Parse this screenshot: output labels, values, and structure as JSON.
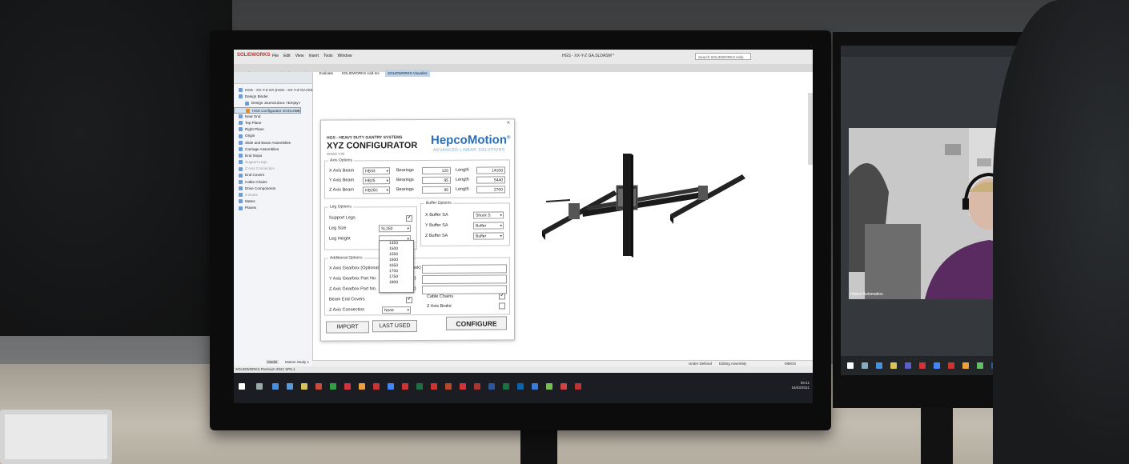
{
  "solidworks": {
    "logo": "SOLIDWORKS",
    "menu": [
      "File",
      "Edit",
      "View",
      "Insert",
      "Tools",
      "Window"
    ],
    "title": "HGS - XX-Y-Z GA.SLDASM *",
    "search_placeholder": "Search SOLIDWORKS Help",
    "tabs": [
      "Assembly",
      "Layout",
      "Sketch",
      "Markup",
      "Evaluate",
      "SOLIDWORKS Add-Ins",
      "SOLIDWORKS Visualize"
    ],
    "active_tab": "SOLIDWORKS Visualize",
    "tree": [
      {
        "label": "HGS - XX-Y-Z GA (HGS - XX-Y-Z GA<Disp",
        "level": 0,
        "state": "normal"
      },
      {
        "label": "Design Binder",
        "level": 0,
        "state": "normal"
      },
      {
        "label": "Design Journal.docx <Empty>",
        "level": 1,
        "state": "normal"
      },
      {
        "label": "HGS Configurator v0.93.xlsm",
        "level": 1,
        "state": "selected"
      },
      {
        "label": "Equations",
        "level": 0,
        "state": "normal"
      },
      {
        "label": "Near End",
        "level": 0,
        "state": "normal"
      },
      {
        "label": "Top Plane",
        "level": 0,
        "state": "normal"
      },
      {
        "label": "Right Plane",
        "level": 0,
        "state": "normal"
      },
      {
        "label": "Origin",
        "level": 0,
        "state": "normal"
      },
      {
        "label": "Slide and Beam Assemblies",
        "level": 0,
        "state": "normal"
      },
      {
        "label": "Carriage Assemblies",
        "level": 0,
        "state": "normal"
      },
      {
        "label": "End Stops",
        "level": 0,
        "state": "normal"
      },
      {
        "label": "Support Legs",
        "level": 0,
        "state": "dim"
      },
      {
        "label": "Z Axis Connection",
        "level": 0,
        "state": "dim"
      },
      {
        "label": "End Covers",
        "level": 0,
        "state": "normal"
      },
      {
        "label": "Cable Chains",
        "level": 0,
        "state": "normal"
      },
      {
        "label": "Drive Components",
        "level": 0,
        "state": "normal"
      },
      {
        "label": "Z Brake",
        "level": 0,
        "state": "dim"
      },
      {
        "label": "Mates",
        "level": 0,
        "state": "normal"
      },
      {
        "label": "Planes",
        "level": 0,
        "state": "normal"
      }
    ],
    "status_left": "SOLIDWORKS Premium 2021 SP5.1",
    "status_under": "Under Defined",
    "status_editing": "Editing Assembly",
    "status_units": "MMGS",
    "bottom_tabs": [
      "Model",
      "Motion Study 1"
    ],
    "clock_time": "09:41",
    "clock_date": "16/03/2021"
  },
  "configurator": {
    "company": "HGS - HEAVY DUTY GANTRY SYSTEMS",
    "title": "XYZ CONFIGURATOR",
    "version": "Version 0.93",
    "brand": "HepcoMotion",
    "brand_mark": "®",
    "brand_sub": "ADVANCED LINEAR SOLUTIONS",
    "axis_options": {
      "title": "Axis Options",
      "rows": [
        {
          "label": "X Axis Beam",
          "beam": "HB33",
          "bearings_label": "Bearings",
          "bearings": "120",
          "length_label": "Length",
          "length": "14100"
        },
        {
          "label": "Y Axis Beam",
          "beam": "HB25",
          "bearings_label": "Bearings",
          "bearings": "95",
          "length_label": "Length",
          "length": "5440"
        },
        {
          "label": "Z Axis Beam",
          "beam": "HB25C",
          "bearings_label": "Bearings",
          "bearings": "95",
          "length_label": "Length",
          "length": "2760"
        }
      ]
    },
    "leg_options": {
      "title": "Leg Options",
      "support_legs_label": "Support Legs",
      "support_legs_checked": "✔",
      "leg_size_label": "Leg Size",
      "leg_size": "SL250",
      "leg_height_label": "Leg Height",
      "leg_height": ""
    },
    "leg_height_options": [
      "1450",
      "1500",
      "1550",
      "1600",
      "1650",
      "1700",
      "1750",
      "1800"
    ],
    "buffer_options": {
      "title": "Buffer Options",
      "rows": [
        {
          "label": "X Buffer SA",
          "value": "Shock S"
        },
        {
          "label": "Y Buffer SA",
          "value": "Buffer"
        },
        {
          "label": "Z Buffer SA",
          "value": "Buffer"
        }
      ]
    },
    "additional_options": {
      "title": "Additional Options",
      "x_gearbox": "X Axis Gearbox (Optional)",
      "x_gearbox_tail": "ook)",
      "y_gearbox": "Y Axis Gearbox Part No.",
      "y_gearbox_tail": "k)",
      "z_gearbox": "Z Axis Gearbox Part No.",
      "z_gearbox_tail": "k)",
      "beam_end_covers": "Beam End Covers",
      "beam_end_covers_checked": "✔",
      "z_connection_label": "Z Axis Connection",
      "z_connection": "None",
      "cable_chains": "Cable Chains",
      "cable_chains_checked": "✔",
      "z_axis_brake": "Z Axis Brake",
      "z_axis_brake_checked": ""
    },
    "buttons": {
      "import": "IMPORT",
      "last_used": "LAST USED",
      "configure": "CONFIGURE"
    }
  },
  "monitor": {
    "brand": "AOC"
  },
  "video_call": {
    "participant": "Hepco Automation"
  }
}
